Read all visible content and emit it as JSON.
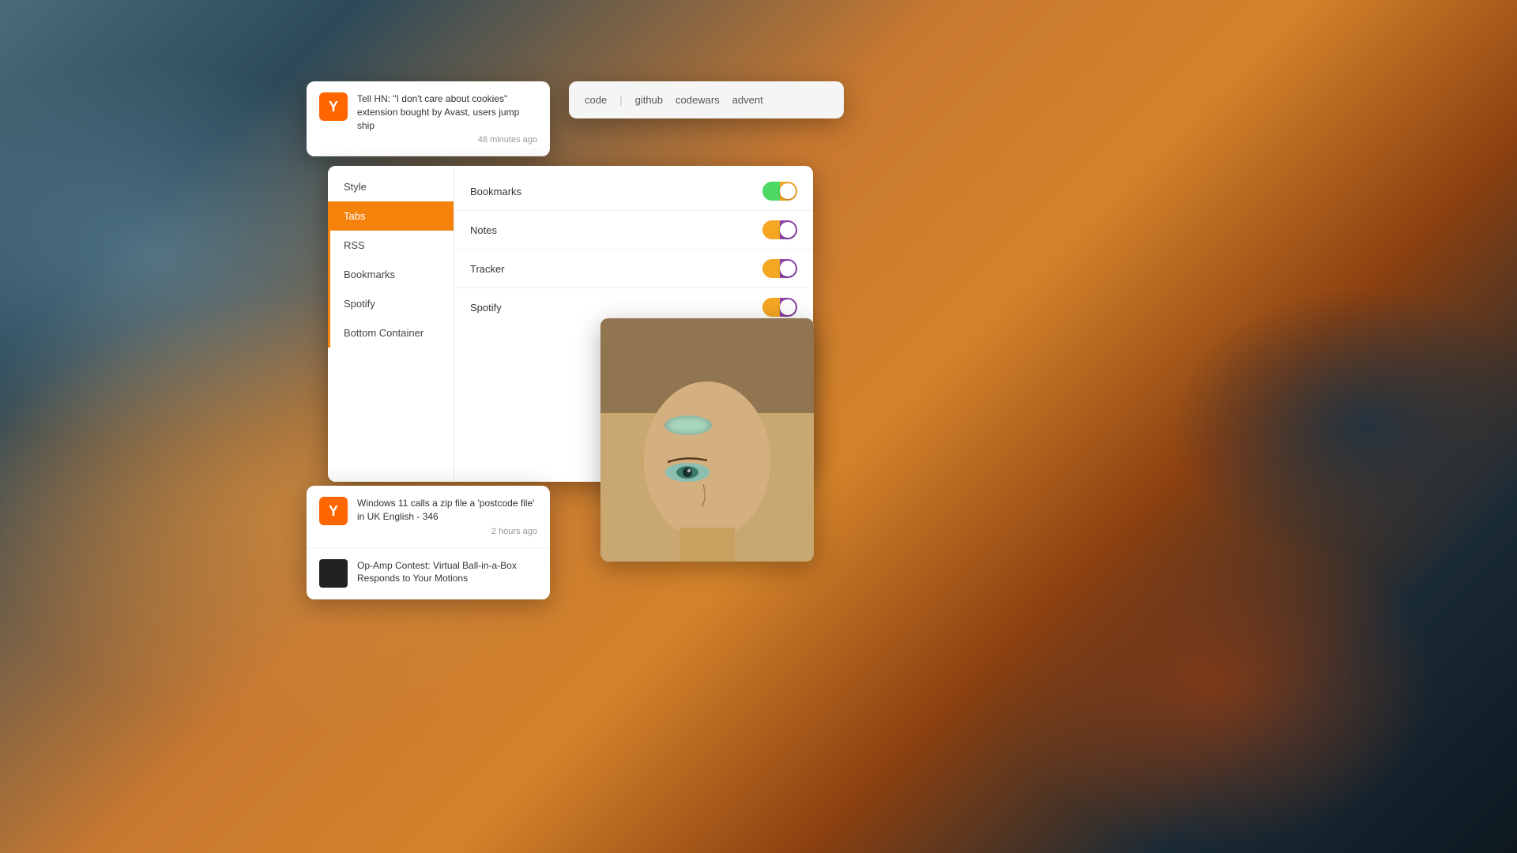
{
  "background": {
    "description": "Cloudy sky background with orange and dark teal clouds"
  },
  "hn_window_top": {
    "logo_letter": "Y",
    "item": {
      "title": "Tell HN: \"I don't care about cookies\" extension bought by Avast, users jump ship",
      "time": "48 minutes ago"
    }
  },
  "code_window": {
    "nav_items": [
      "code",
      "|",
      "github",
      "codewars",
      "advent"
    ]
  },
  "settings_panel": {
    "sidebar": {
      "items": [
        {
          "label": "Style",
          "active": false
        },
        {
          "label": "Tabs",
          "active": true
        },
        {
          "label": "RSS",
          "active": false
        },
        {
          "label": "Bookmarks",
          "active": false
        },
        {
          "label": "Spotify",
          "active": false
        },
        {
          "label": "Bottom Container",
          "active": false
        }
      ]
    },
    "content": {
      "toggles": [
        {
          "label": "Bookmarks",
          "state": "on-green"
        },
        {
          "label": "Notes",
          "state": "on-yellow"
        },
        {
          "label": "Tracker",
          "state": "on-yellow"
        },
        {
          "label": "Spotify",
          "state": "on-yellow"
        }
      ]
    }
  },
  "hn_window_bottom": {
    "items": [
      {
        "logo_letter": "Y",
        "logo_bg": "#ff6600",
        "title": "Windows 11 calls a zip file a 'postcode file' in UK English - 346",
        "time": "2 hours ago"
      },
      {
        "logo_letter": "",
        "logo_bg": "#333",
        "title": "Op-Amp Contest: Virtual Ball-in-a-Box Responds to Your Motions",
        "time": ""
      }
    ]
  }
}
